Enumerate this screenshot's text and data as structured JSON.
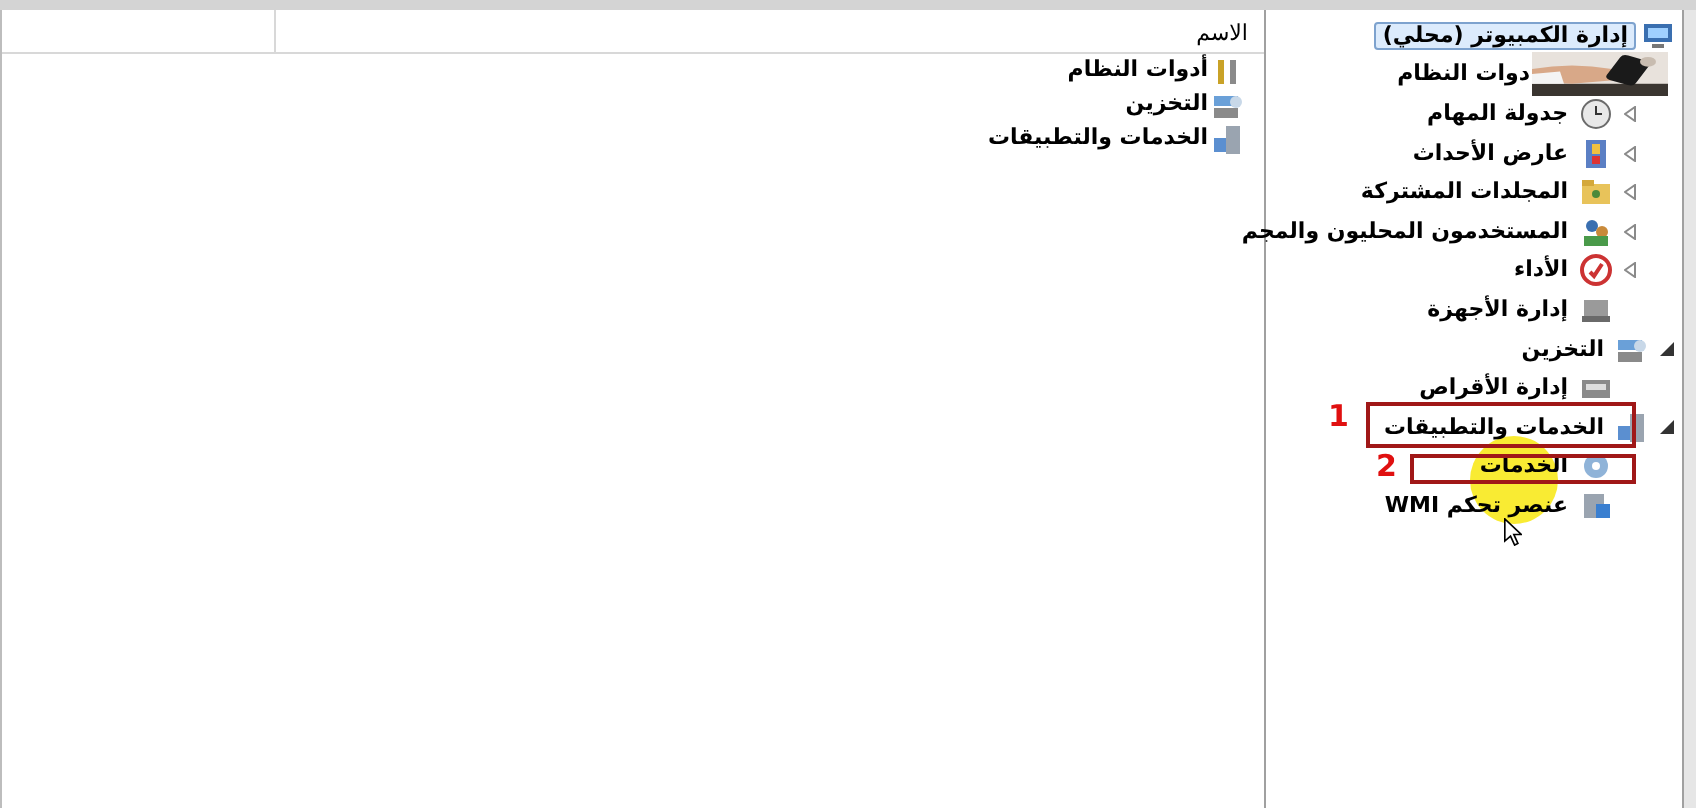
{
  "list_pane": {
    "columns": [
      "الاسم"
    ],
    "items": [
      {
        "label": "أدوات النظام"
      },
      {
        "label": "التخزين"
      },
      {
        "label": "الخدمات والتطبيقات"
      }
    ]
  },
  "tree": [
    {
      "label": "إدارة الكمبيوتر (محلي)",
      "selected": true,
      "children": [
        {
          "label": "دوات النظام",
          "selected": false,
          "children": [
            {
              "label": "جدولة المهام",
              "expanded": false,
              "selected": false
            },
            {
              "label": "عارض الأحداث",
              "expanded": false,
              "selected": false
            },
            {
              "label": "المجلدات المشتركة",
              "expanded": false,
              "selected": false
            },
            {
              "label": "المستخدمون المحليون والمجم",
              "expanded": false,
              "selected": false
            },
            {
              "label": "الأداء",
              "expanded": false,
              "selected": false
            },
            {
              "label": "إدارة الأجهزة",
              "selected": false
            }
          ]
        },
        {
          "label": "التخزين",
          "expanded": true,
          "selected": false,
          "children": [
            {
              "label": "إدارة الأقراص",
              "selected": false
            }
          ]
        },
        {
          "label": "الخدمات والتطبيقات",
          "expanded": true,
          "selected": false,
          "children": [
            {
              "label": "الخدمات",
              "selected": false
            },
            {
              "label": "عنصر تحكم WMI",
              "selected": false
            }
          ]
        }
      ]
    }
  ],
  "annotations": [
    {
      "label": "1"
    },
    {
      "label": "2"
    }
  ]
}
